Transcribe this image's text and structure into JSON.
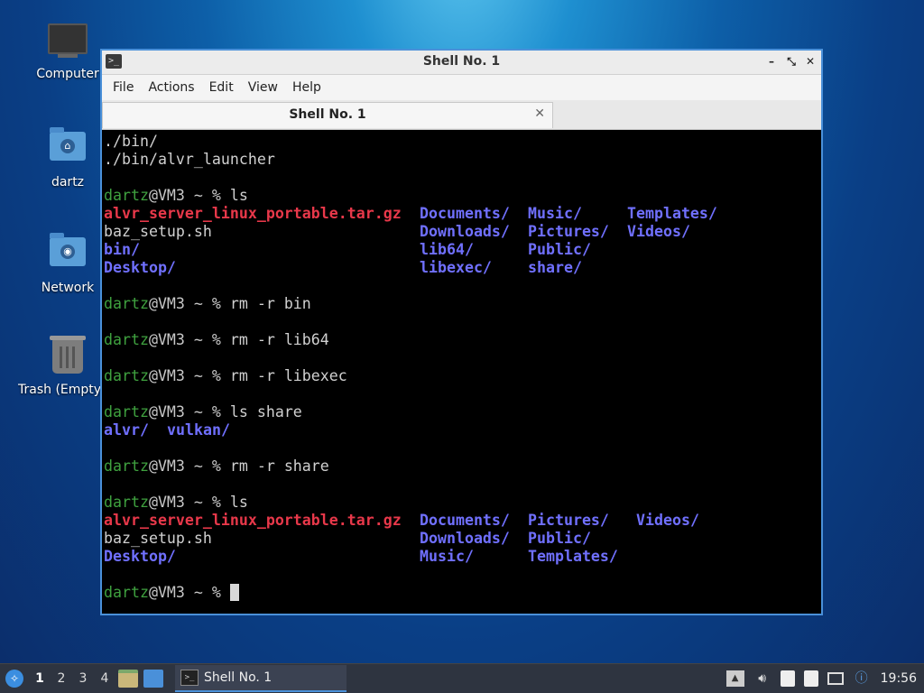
{
  "desktop": {
    "icons": [
      {
        "label": "Computer"
      },
      {
        "label": "dartz"
      },
      {
        "label": "Network"
      },
      {
        "label": "Trash (Empty)"
      }
    ]
  },
  "window": {
    "title": "Shell No. 1",
    "controls": {
      "minimize": "–",
      "restore": "⤡",
      "close": "✕"
    },
    "menu": [
      "File",
      "Actions",
      "Edit",
      "View",
      "Help"
    ],
    "tab": {
      "label": "Shell No. 1",
      "close": "✕"
    }
  },
  "terminal": {
    "prompt_user": "dartz",
    "prompt_rest": "@VM3 ~ % ",
    "lines": [
      "./bin/",
      "./bin/alvr_launcher",
      "",
      "ls",
      "",
      "",
      "",
      "",
      "",
      "rm -r bin",
      "",
      "rm -r lib64",
      "",
      "rm -r libexec",
      "",
      "ls share",
      "",
      "",
      "rm -r share",
      "",
      "ls",
      "",
      "",
      "",
      "",
      ""
    ],
    "ls1": [
      [
        "alvr_server_linux_portable.tar.gz",
        "Documents/",
        "Music/",
        "Templates/"
      ],
      [
        "baz_setup.sh",
        "Downloads/",
        "Pictures/",
        "Videos/"
      ],
      [
        "bin/",
        "lib64/",
        "Public/",
        ""
      ],
      [
        "Desktop/",
        "libexec/",
        "share/",
        ""
      ]
    ],
    "ls_share": [
      "alvr/",
      "vulkan/"
    ],
    "ls2": [
      [
        "alvr_server_linux_portable.tar.gz",
        "Documents/",
        "Pictures/",
        "Videos/"
      ],
      [
        "baz_setup.sh",
        "Downloads/",
        "Public/",
        ""
      ],
      [
        "Desktop/",
        "Music/",
        "Templates/",
        ""
      ]
    ]
  },
  "taskbar": {
    "workspaces": [
      "1",
      "2",
      "3",
      "4"
    ],
    "task_label": "Shell No. 1",
    "clock": "19:56"
  },
  "colors": {
    "prompt_user": "#3fa13f",
    "archive": "#e8384a",
    "directory": "#7070ff",
    "window_border": "#4a90d9"
  }
}
